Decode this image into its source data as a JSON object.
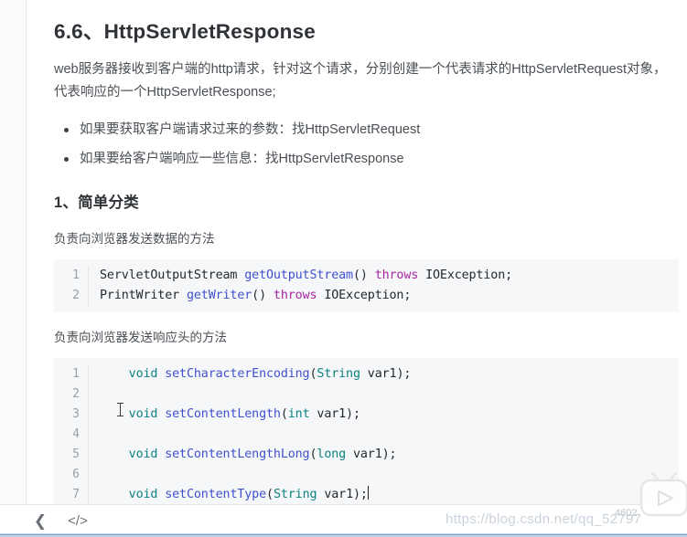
{
  "document": {
    "heading": "6.6、HttpServletResponse",
    "intro_paragraph": "web服务器接收到客户端的http请求，针对这个请求，分别创建一个代表请求的HttpServletRequest对象，代表响应的一个HttpServletResponse;",
    "bullets": [
      "如果要获取客户端请求过来的参数：找HttpServletRequest",
      "如果要给客户端响应一些信息：找HttpServletResponse"
    ],
    "section_heading": "1、简单分类",
    "caption_1": "负责向浏览器发送数据的方法",
    "caption_2": "负责向浏览器发送响应头的方法"
  },
  "code_block_1": {
    "language": "java",
    "lines": [
      {
        "number": "1",
        "tokens": [
          {
            "text": "ServletOutputStream ",
            "type": "plain"
          },
          {
            "text": "getOutputStream",
            "type": "fn"
          },
          {
            "text": "() ",
            "type": "punc"
          },
          {
            "text": "throws",
            "type": "kw"
          },
          {
            "text": " IOException;",
            "type": "plain"
          }
        ]
      },
      {
        "number": "2",
        "tokens": [
          {
            "text": "PrintWriter ",
            "type": "plain"
          },
          {
            "text": "getWriter",
            "type": "fn"
          },
          {
            "text": "() ",
            "type": "punc"
          },
          {
            "text": "throws",
            "type": "kw"
          },
          {
            "text": " IOException;",
            "type": "plain"
          }
        ]
      }
    ]
  },
  "code_block_2": {
    "language": "java",
    "lines": [
      {
        "number": "1",
        "tokens": [
          {
            "text": "    ",
            "type": "plain"
          },
          {
            "text": "void",
            "type": "type"
          },
          {
            "text": " ",
            "type": "plain"
          },
          {
            "text": "setCharacterEncoding",
            "type": "fn"
          },
          {
            "text": "(",
            "type": "punc"
          },
          {
            "text": "String",
            "type": "type"
          },
          {
            "text": " var1);",
            "type": "plain"
          }
        ]
      },
      {
        "number": "2",
        "tokens": []
      },
      {
        "number": "3",
        "tokens": [
          {
            "text": "    ",
            "type": "plain"
          },
          {
            "text": "void",
            "type": "type"
          },
          {
            "text": " ",
            "type": "plain"
          },
          {
            "text": "setContentLength",
            "type": "fn"
          },
          {
            "text": "(",
            "type": "punc"
          },
          {
            "text": "int",
            "type": "type"
          },
          {
            "text": " var1);",
            "type": "plain"
          }
        ]
      },
      {
        "number": "4",
        "tokens": []
      },
      {
        "number": "5",
        "tokens": [
          {
            "text": "    ",
            "type": "plain"
          },
          {
            "text": "void",
            "type": "type"
          },
          {
            "text": " ",
            "type": "plain"
          },
          {
            "text": "setContentLengthLong",
            "type": "fn"
          },
          {
            "text": "(",
            "type": "punc"
          },
          {
            "text": "long",
            "type": "type"
          },
          {
            "text": " var1);",
            "type": "plain"
          }
        ]
      },
      {
        "number": "6",
        "tokens": []
      },
      {
        "number": "7",
        "tokens": [
          {
            "text": "    ",
            "type": "plain"
          },
          {
            "text": "void",
            "type": "type"
          },
          {
            "text": " ",
            "type": "plain"
          },
          {
            "text": "setContentType",
            "type": "fn"
          },
          {
            "text": "(",
            "type": "punc"
          },
          {
            "text": "String",
            "type": "type"
          },
          {
            "text": " var1);",
            "type": "plain"
          }
        ],
        "caret": true
      }
    ]
  },
  "bottom_bar": {
    "back_icon": "chevron-left-icon",
    "back_glyph": "❮",
    "code_icon": "code-brackets-icon",
    "code_glyph": "</>"
  },
  "watermarks": {
    "url": "https://blog.csdn.net/qq_52797",
    "number": "4602",
    "logo": "bilibili-tv-logo"
  },
  "colors": {
    "code_background": "#f6f7f8",
    "token_type": "#0d8282",
    "token_function": "#3f51cf",
    "token_keyword": "#a626a4",
    "token_plain": "#24292e",
    "heading": "#2f3338",
    "body_text": "#4a4f55",
    "gutter_number": "#9aa0a6",
    "watermark": "#c9d2dc"
  }
}
